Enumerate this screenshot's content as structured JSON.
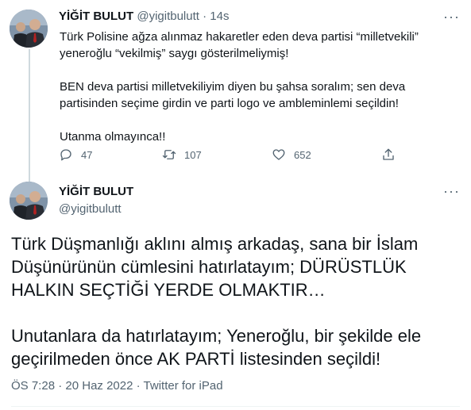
{
  "tweet1": {
    "name": "YİĞİT BULUT",
    "handle": "@yigitbulutt",
    "sep": "·",
    "time": "14s",
    "more": "···",
    "lines": [
      "Türk Polisine ağza alınmaz hakaretler eden deva partisi “milletvekili”",
      "yeneroğlu “vekilmiş” saygı gösterilmeliymiş!",
      "",
      "BEN deva partisi milletvekiliyim diyen bu şahsa soralım; sen deva",
      "partisinden seçime girdin ve parti logo ve ambleminlemi seçildin!",
      "",
      "Utanma olmayınca!!"
    ],
    "actions": {
      "reply_icon": "reply-icon",
      "reply_count": "47",
      "retweet_icon": "retweet-icon",
      "retweet_count": "107",
      "like_icon": "heart-icon",
      "like_count": "652",
      "share_icon": "share-icon"
    }
  },
  "tweet2": {
    "name": "YİĞİT BULUT",
    "handle": "@yigitbulutt",
    "more": "···",
    "lines": [
      "Türk Düşmanlığı aklını almış arkadaş, sana bir İslam",
      "Düşünürünün cümlesini hatırlatayım; DÜRÜSTLÜK",
      "HALKIN SEÇTİĞİ YERDE OLMAKTIR…",
      "",
      "Unutanlara da hatırlatayım; Yeneroğlu, bir şekilde ele",
      "geçirilmeden önce AK PARTİ listesinden seçildi!"
    ],
    "time": "ÖS 7:28",
    "sep1": "·",
    "date": "20 Haz 2022",
    "sep2": "·",
    "source": "Twitter for iPad"
  },
  "colors": {
    "text": "#0f1419",
    "muted": "#536471",
    "thread_line": "#cfd9de"
  }
}
